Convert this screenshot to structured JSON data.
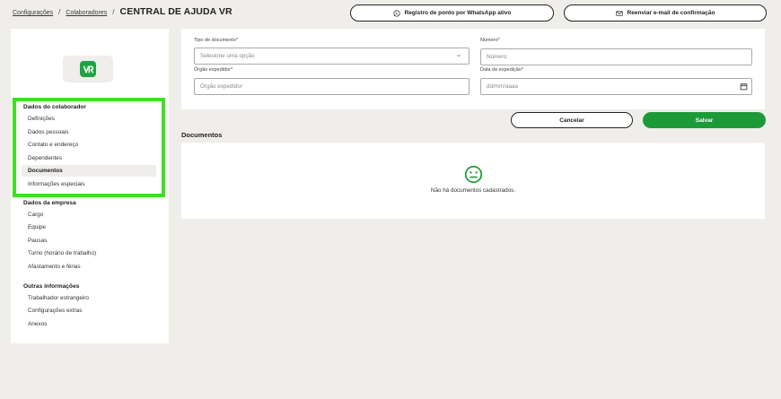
{
  "breadcrumb": {
    "items": [
      "Configurações",
      "Colaboradores"
    ],
    "separator": "/",
    "current": "CENTRAL DE AJUDA VR"
  },
  "header": {
    "whatsapp_button": "Registro de ponto por WhatsApp ativo",
    "email_button": "Reenviar e-mail de confirmação"
  },
  "logo": {
    "text": "VR",
    "color": "#1ea342"
  },
  "sidebar": {
    "sections": [
      {
        "title": "Dados do colaborador",
        "items": [
          "Definições",
          "Dados pessoais",
          "Contato e endereço",
          "Dependentes",
          "Documentos",
          "Informações especiais"
        ]
      },
      {
        "title": "Dados da empresa",
        "items": [
          "Cargo",
          "Equipe",
          "Pausas",
          "Turno (horário de trabalho)",
          "Afastamento e férias"
        ]
      },
      {
        "title": "Outras informações",
        "items": [
          "Trabalhador estrangeiro",
          "Configurações extras",
          "Anexos"
        ]
      }
    ],
    "active_item": "Documentos",
    "highlight_color": "#3ee024"
  },
  "form": {
    "doc_type_label": "Tipo de documento*",
    "doc_type_placeholder": "Selecione uma opção",
    "number_label": "Número*",
    "number_placeholder": "Número",
    "issuer_label": "Órgão expedidor*",
    "issuer_placeholder": "Órgão expedidor",
    "issue_date_label": "Data de expedição*",
    "issue_date_placeholder": "dd/mm/aaaa"
  },
  "actions": {
    "cancel": "Cancelar",
    "save": "Salvar",
    "save_color": "#1d9a38"
  },
  "documents": {
    "title": "Documentos",
    "empty_message": "Não há documentos cadastrados."
  }
}
